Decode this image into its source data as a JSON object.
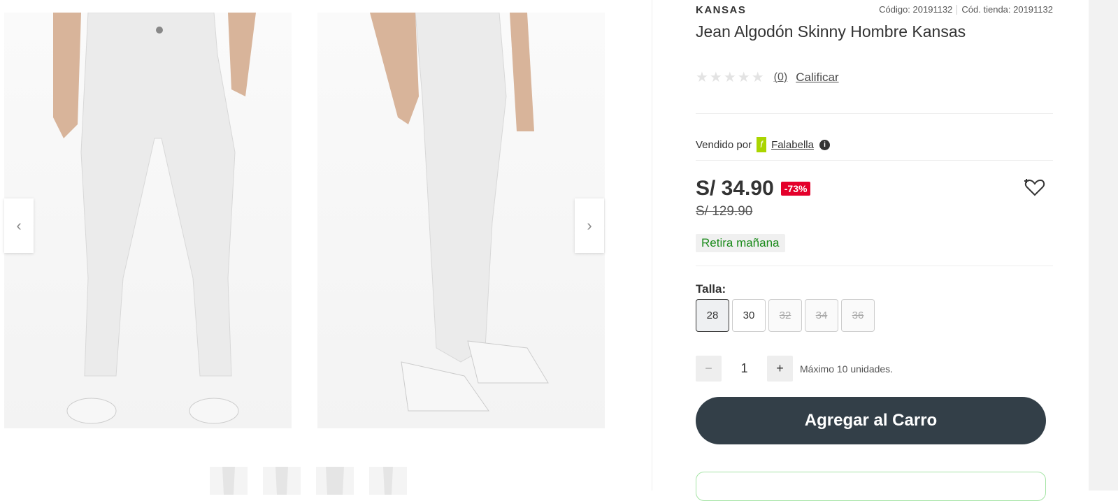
{
  "product": {
    "brand": "KANSAS",
    "code": "Código: 20191132",
    "store_code": "Cód. tienda: 20191132",
    "title": "Jean Algodón Skinny Hombre Kansas",
    "rating_count": "(0)",
    "rate_label": "Calificar",
    "stars": "★★★★★"
  },
  "seller": {
    "sold_by": "Vendido por",
    "logo_letter": "f",
    "name": "Falabella",
    "info": "i"
  },
  "price": {
    "current": "S/ 34.90",
    "discount": "-73%",
    "original": "S/ 129.90",
    "pickup": "Retira mañana"
  },
  "size": {
    "label": "Talla:",
    "options": [
      {
        "value": "28",
        "state": "selected"
      },
      {
        "value": "30",
        "state": "available"
      },
      {
        "value": "32",
        "state": "disabled"
      },
      {
        "value": "34",
        "state": "disabled"
      },
      {
        "value": "36",
        "state": "disabled"
      }
    ]
  },
  "quantity": {
    "minus": "−",
    "value": "1",
    "plus": "+",
    "note": "Máximo 10 unidades."
  },
  "cart": {
    "add_label": "Agregar al Carro"
  },
  "gallery": {
    "prev_icon": "‹",
    "next_icon": "›"
  },
  "colors": {
    "accent_dark": "#333f48",
    "discount_red": "#e4002b",
    "pickup_green": "#1a8a1a",
    "falabella_green": "#aad500"
  }
}
